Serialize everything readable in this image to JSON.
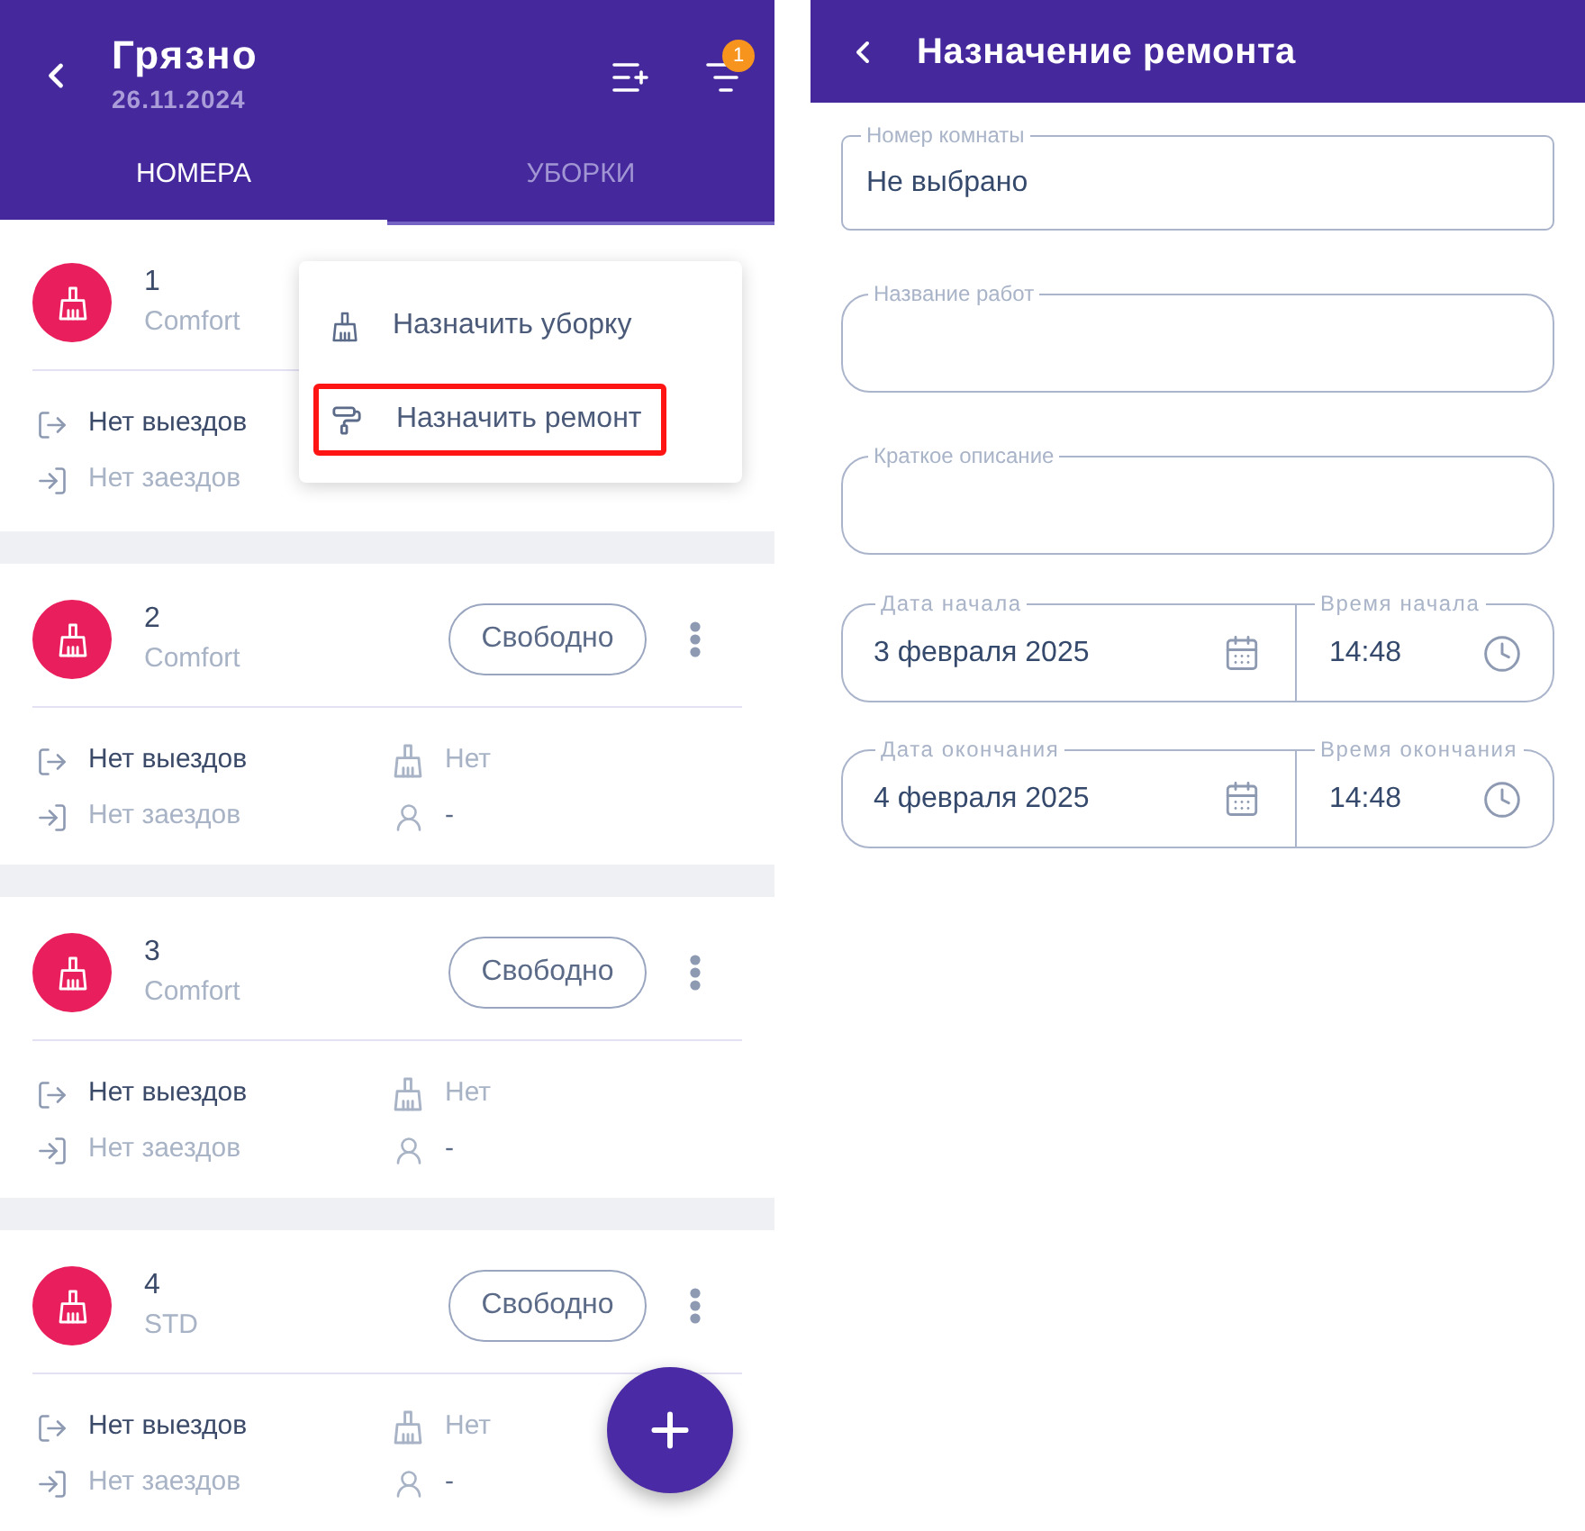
{
  "left_screen": {
    "app_bar": {
      "title": "Грязно",
      "subtitle": "26.11.2024",
      "filter_badge": "1"
    },
    "tabs": [
      {
        "label": "НОМЕРА",
        "selected": true
      },
      {
        "label": "УБОРКИ",
        "selected": false
      }
    ],
    "rooms": [
      {
        "number": "1",
        "category": "Comfort",
        "check_out": "Нет выездов",
        "check_in": "Нет заездов"
      },
      {
        "number": "2",
        "category": "Comfort",
        "status": "Свободно",
        "check_out": "Нет выездов",
        "check_in": "Нет заездов",
        "cleaner": "Нет",
        "assignee": "-"
      },
      {
        "number": "3",
        "category": "Comfort",
        "status": "Свободно",
        "check_out": "Нет выездов",
        "check_in": "Нет заездов",
        "cleaner": "Нет",
        "assignee": "-"
      },
      {
        "number": "4",
        "category": "STD",
        "status": "Свободно",
        "check_out": "Нет выездов",
        "check_in": "Нет заездов",
        "cleaner": "Нет",
        "assignee": "-"
      }
    ],
    "context_menu": {
      "items": [
        {
          "kind": "cleaning",
          "label": "Назначить уборку",
          "highlighted": false
        },
        {
          "kind": "repair",
          "label": "Назначить ремонт",
          "highlighted": true
        }
      ]
    }
  },
  "right_screen": {
    "title": "Назначение ремонта",
    "fields": [
      {
        "kind": "select",
        "label": "Номер комнаты",
        "value": "Не выбрано"
      },
      {
        "kind": "text",
        "label": "Название работ"
      },
      {
        "kind": "text",
        "label": "Краткое описание"
      }
    ],
    "schedule": [
      {
        "date_label": "Дата начала",
        "date": "3 февраля 2025",
        "time_label": "Время начала",
        "time": "14:48"
      },
      {
        "date_label": "Дата окончания",
        "date": "4 февраля 2025",
        "time_label": "Время окончания",
        "time": "14:48"
      }
    ]
  }
}
